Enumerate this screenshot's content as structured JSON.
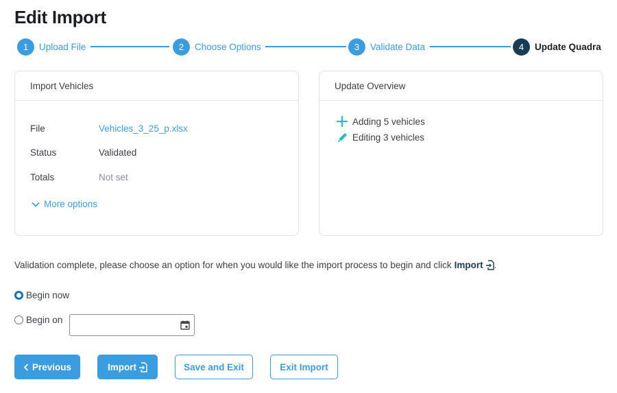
{
  "page": {
    "title": "Edit Import"
  },
  "stepper": {
    "steps": [
      {
        "number": "1",
        "label": "Upload File"
      },
      {
        "number": "2",
        "label": "Choose Options"
      },
      {
        "number": "3",
        "label": "Validate Data"
      },
      {
        "number": "4",
        "label": "Update Quadra"
      }
    ]
  },
  "import_card": {
    "title": "Import Vehicles",
    "rows": [
      {
        "key": "File",
        "value": "Vehicles_3_25_p.xlsx"
      },
      {
        "key": "Status",
        "value": "Validated"
      },
      {
        "key": "Totals",
        "value": "Not set"
      }
    ],
    "more_options": "More options"
  },
  "overview_card": {
    "title": "Update Overview",
    "items": [
      {
        "icon": "plus-icon",
        "text": "Adding 5 vehicles"
      },
      {
        "icon": "pencil-icon",
        "text": "Editing 3 vehicles"
      }
    ]
  },
  "instruction": {
    "text": "Validation complete, please choose an option for when you would like the import process to begin and click",
    "action": "Import",
    "suffix": "."
  },
  "schedule": {
    "options": [
      {
        "label": "Begin now",
        "checked": true
      },
      {
        "label": "Begin on",
        "checked": false
      }
    ],
    "date_value": ""
  },
  "buttons": {
    "previous": "Previous",
    "import": "Import",
    "save_exit": "Save and Exit",
    "exit_import": "Exit Import"
  },
  "colors": {
    "accent": "#3a9de0",
    "active_step": "#183b56",
    "radio_checked": "#1a6fc2",
    "plus_icon": "#27b9c8"
  }
}
